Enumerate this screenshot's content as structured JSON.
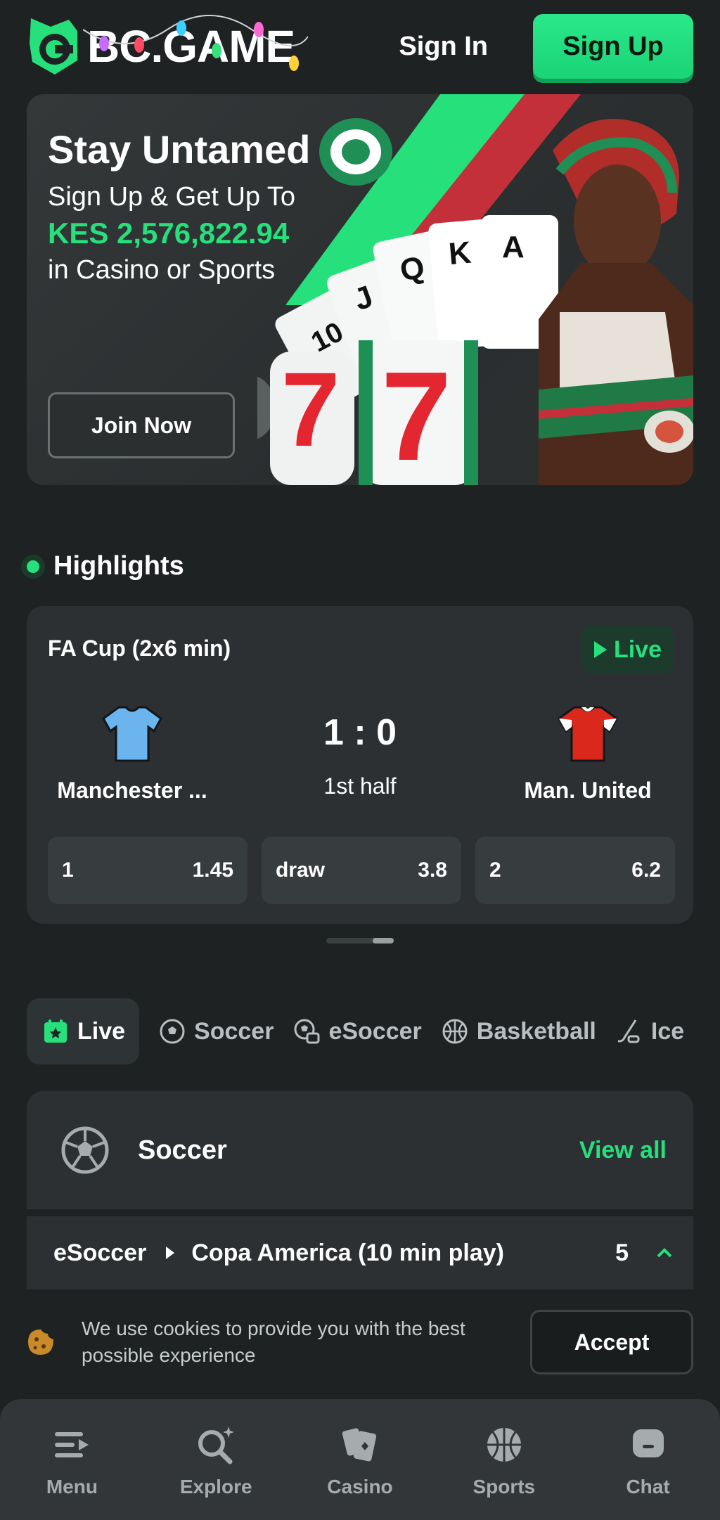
{
  "header": {
    "logo_text": "BC.GAME",
    "signin_label": "Sign In",
    "signup_label": "Sign Up"
  },
  "hero": {
    "title": "Stay Untamed",
    "line1": "Sign Up & Get Up To",
    "amount": "KES 2,576,822.94",
    "line3": "in Casino or Sports",
    "cta": "Join Now",
    "card_letters": [
      "10",
      "J",
      "Q",
      "K",
      "A"
    ],
    "slot_symbol": "7"
  },
  "highlights": {
    "title": "Highlights",
    "match": {
      "league": "FA Cup (2x6 min)",
      "live_label": "Live",
      "home_team": "Manchester ...",
      "away_team": "Man. United",
      "score": "1 : 0",
      "period": "1st half",
      "odds": [
        {
          "label": "1",
          "value": "1.45"
        },
        {
          "label": "draw",
          "value": "3.8"
        },
        {
          "label": "2",
          "value": "6.2"
        }
      ]
    }
  },
  "sport_tabs": [
    {
      "label": "Live",
      "icon": "calendar-star-icon",
      "active": true
    },
    {
      "label": "Soccer",
      "icon": "soccer-ball-icon"
    },
    {
      "label": "eSoccer",
      "icon": "esoccer-icon"
    },
    {
      "label": "Basketball",
      "icon": "basketball-icon"
    },
    {
      "label": "Ice",
      "icon": "ice-hockey-icon"
    }
  ],
  "soccer_section": {
    "title": "Soccer",
    "view_all": "View all",
    "league_row": {
      "category": "eSoccer",
      "league": "Copa America (10 min play)",
      "count": "5"
    }
  },
  "cookie": {
    "text": "We use cookies to provide you with the best possible experience",
    "accept_label": "Accept"
  },
  "bottom_nav": [
    {
      "label": "Menu",
      "icon": "menu-icon"
    },
    {
      "label": "Explore",
      "icon": "explore-icon"
    },
    {
      "label": "Casino",
      "icon": "casino-cards-icon"
    },
    {
      "label": "Sports",
      "icon": "basketball-icon"
    },
    {
      "label": "Chat",
      "icon": "chat-icon"
    }
  ],
  "colors": {
    "background": "#1f2223",
    "card": "#2c3032",
    "accent_green": "#26e07c",
    "home_shirt": "#6cb4ee",
    "away_shirt": "#da291c"
  }
}
